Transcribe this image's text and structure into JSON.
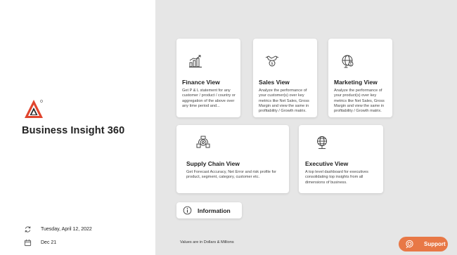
{
  "app": {
    "title": "Business Insight 360",
    "date": "Tuesday, April 12, 2022",
    "period": "Dec 21"
  },
  "cards": {
    "finance": {
      "title": "Finance View",
      "desc": "Get P & L statement for any customer / product / country or aggregation of the above over any time period and...",
      "icon": "finance-chart-icon"
    },
    "sales": {
      "title": "Sales View",
      "desc": "Analyze the performance of your customer(s) over key metrics like Net Sales, Gross Margin and view the same in profitability / Growth matrix.",
      "icon": "sales-handshake-icon"
    },
    "marketing": {
      "title": "Marketing View",
      "desc": "Analyze the performance of your product(s) over key metrics like Net Sales, Gross Margin and view the same in profitability / Growth matrix.",
      "icon": "marketing-globe-icon"
    },
    "supply": {
      "title": "Supply Chain View",
      "desc": "Get Forecast Accuracy, Net Error and risk profile for product, segment, category, customer etc.",
      "icon": "supply-chain-icon"
    },
    "executive": {
      "title": "Executive View",
      "desc": "A top level dashboard for executives consolidating top insights from all dimensions of business.",
      "icon": "executive-globe-icon"
    }
  },
  "info": {
    "label": "Information"
  },
  "footnote": "Values are in Dollars & Millions",
  "support": {
    "label": "Support"
  },
  "colors": {
    "accent": "#e87846",
    "logo_red": "#e0452e",
    "logo_dark": "#2b2b2b",
    "panel": "#e6e6e6"
  }
}
